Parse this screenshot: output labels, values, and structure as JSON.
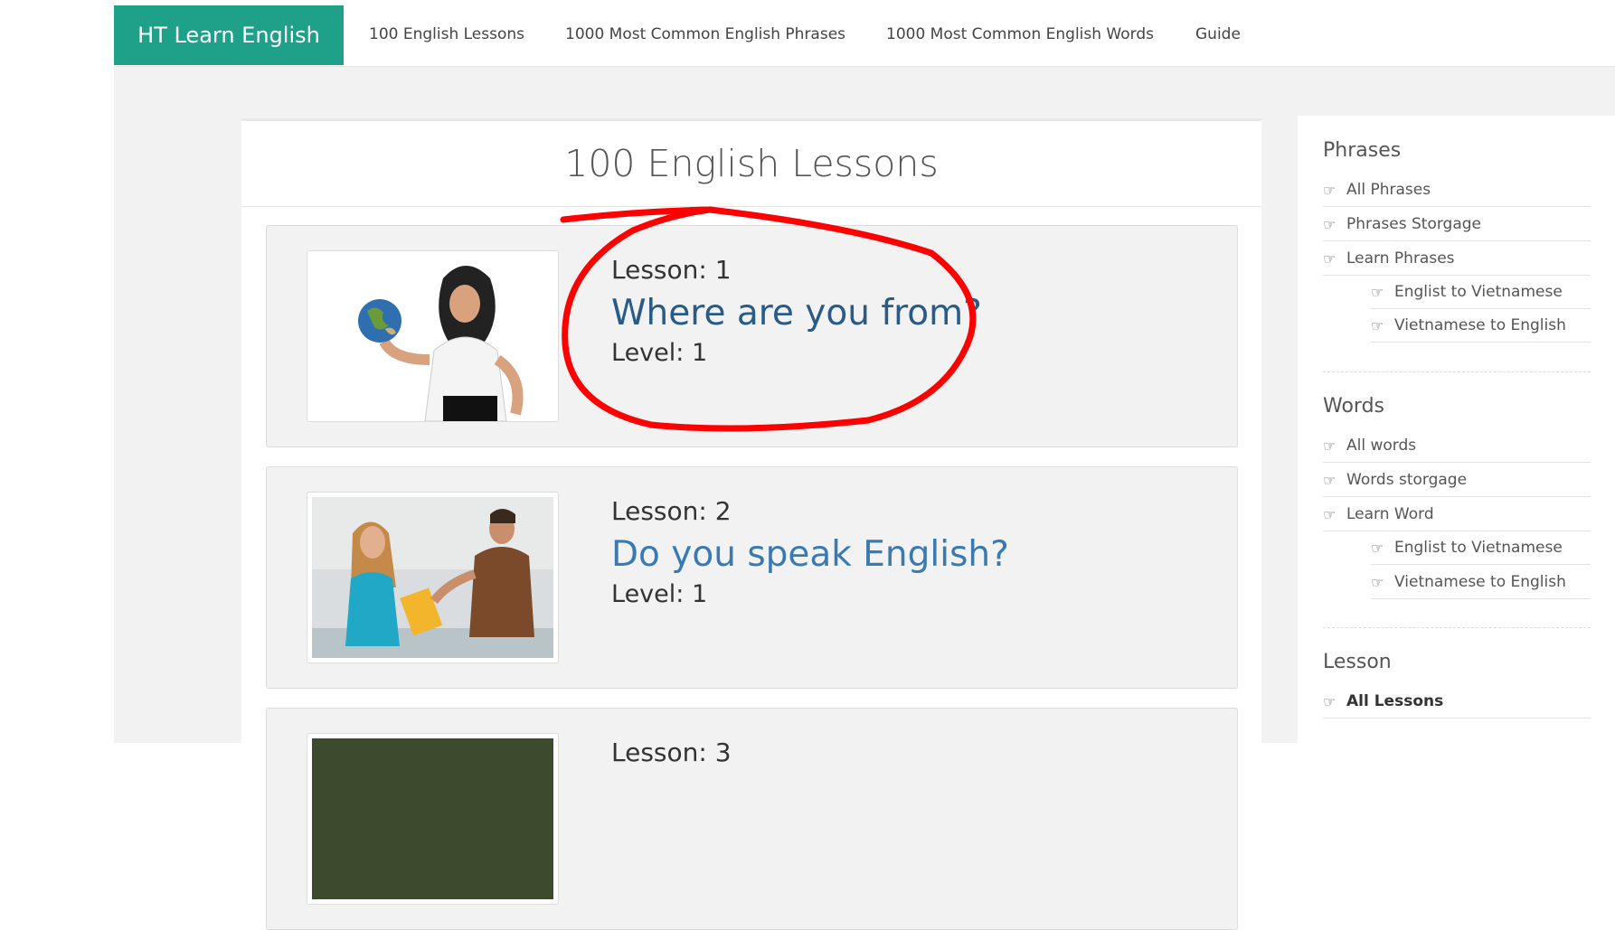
{
  "navbar": {
    "brand": "HT Learn English",
    "links": [
      "100 English Lessons",
      "1000 Most Common English Phrases",
      "1000 Most Common English Words",
      "Guide"
    ]
  },
  "main": {
    "title": "100 English Lessons",
    "lessons": [
      {
        "number": "Lesson: 1",
        "title": "Where are you from?",
        "level": "Level: 1"
      },
      {
        "number": "Lesson: 2",
        "title": "Do you speak English?",
        "level": "Level: 1"
      },
      {
        "number": "Lesson: 3"
      }
    ]
  },
  "sidebar": {
    "phrases": {
      "heading": "Phrases",
      "items": [
        "All Phrases",
        "Phrases Storgage",
        "Learn Phrases",
        "Englist to Vietnamese",
        "Vietnamese to English"
      ]
    },
    "words": {
      "heading": "Words",
      "items": [
        "All words",
        "Words storgage",
        "Learn Word",
        "Englist to Vietnamese",
        "Vietnamese to English"
      ]
    },
    "lesson": {
      "heading": "Lesson",
      "items": [
        "All Lessons"
      ]
    }
  },
  "icons": {
    "list_bullet": "hand-pointing-right-icon"
  },
  "colors": {
    "brand": "#1fa189",
    "link_active": "#2a5a86",
    "link": "#3a7ab3",
    "annotation": "#ff0000"
  }
}
